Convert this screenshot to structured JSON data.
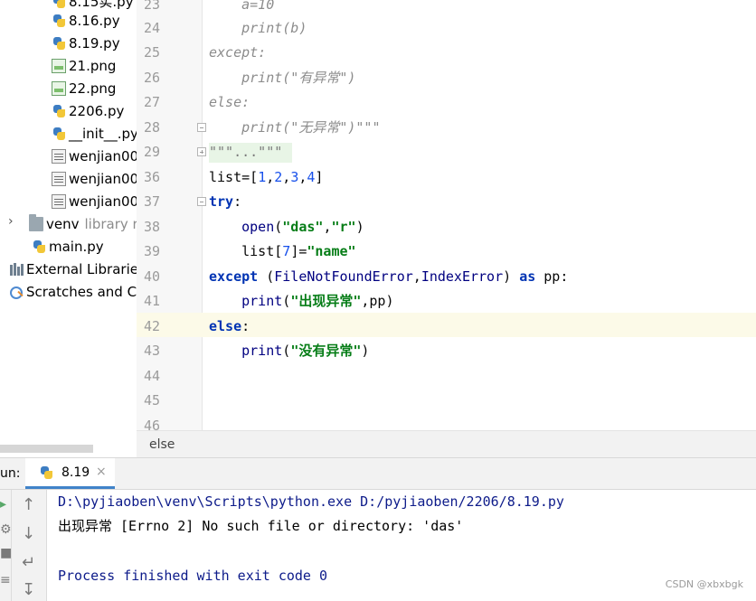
{
  "project_tree": {
    "items": [
      {
        "label": "8.15实.py",
        "icon": "python-file-icon"
      },
      {
        "label": "8.16.py",
        "icon": "python-file-icon"
      },
      {
        "label": "8.19.py",
        "icon": "python-file-icon"
      },
      {
        "label": "21.png",
        "icon": "image-file-icon"
      },
      {
        "label": "22.png",
        "icon": "image-file-icon"
      },
      {
        "label": "2206.py",
        "icon": "python-file-icon"
      },
      {
        "label": "__init__.py",
        "icon": "python-file-icon"
      },
      {
        "label": "wenjian00",
        "icon": "text-file-icon"
      },
      {
        "label": "wenjian00",
        "icon": "text-file-icon"
      },
      {
        "label": "wenjian00",
        "icon": "text-file-icon"
      },
      {
        "label": "venv",
        "hint": "library r",
        "icon": "folder-icon"
      },
      {
        "label": "main.py",
        "icon": "python-file-icon"
      },
      {
        "label": "External Librarie",
        "icon": "library-icon"
      },
      {
        "label": "Scratches and Co",
        "icon": "scratch-icon"
      }
    ]
  },
  "editor": {
    "lines": [
      {
        "no": "23",
        "text": "    a=10"
      },
      {
        "no": "24",
        "text": "    print(b)"
      },
      {
        "no": "25",
        "text": "except:"
      },
      {
        "no": "26",
        "text": "    print(\"有异常\")"
      },
      {
        "no": "27",
        "text": "else:"
      },
      {
        "no": "28",
        "text": "    print(\"无异常\")\"\"\""
      },
      {
        "no": "29",
        "text": "\"\"\"...\"\"\""
      },
      {
        "no": "36",
        "text": "list=[1,2,3,4]"
      },
      {
        "no": "37",
        "text": "try:"
      },
      {
        "no": "38",
        "text": "    open(\"das\",\"r\")"
      },
      {
        "no": "39",
        "text": "    list[7]=\"name\""
      },
      {
        "no": "40",
        "text": "except (FileNotFoundError,IndexError) as pp:"
      },
      {
        "no": "41",
        "text": "    print(\"出现异常\",pp)"
      },
      {
        "no": "42",
        "text": "else:"
      },
      {
        "no": "43",
        "text": "    print(\"没有异常\")"
      },
      {
        "no": "44",
        "text": ""
      },
      {
        "no": "45",
        "text": ""
      },
      {
        "no": "46",
        "text": ""
      }
    ],
    "breadcrumb": "else"
  },
  "run": {
    "label": "un:",
    "tab_label": "8.19",
    "close_glyph": "×",
    "console": {
      "command": "D:\\pyjiaoben\\venv\\Scripts\\python.exe D:/pyjiaoben/2206/8.19.py",
      "output": "出现异常 [Errno 2] No such file or directory: 'das'",
      "exit": "Process finished with exit code 0"
    },
    "tools": [
      "up-arrow-icon",
      "down-arrow-icon",
      "soft-wrap-icon",
      "scroll-to-end-icon"
    ]
  },
  "watermark": "CSDN @xbxbgk"
}
